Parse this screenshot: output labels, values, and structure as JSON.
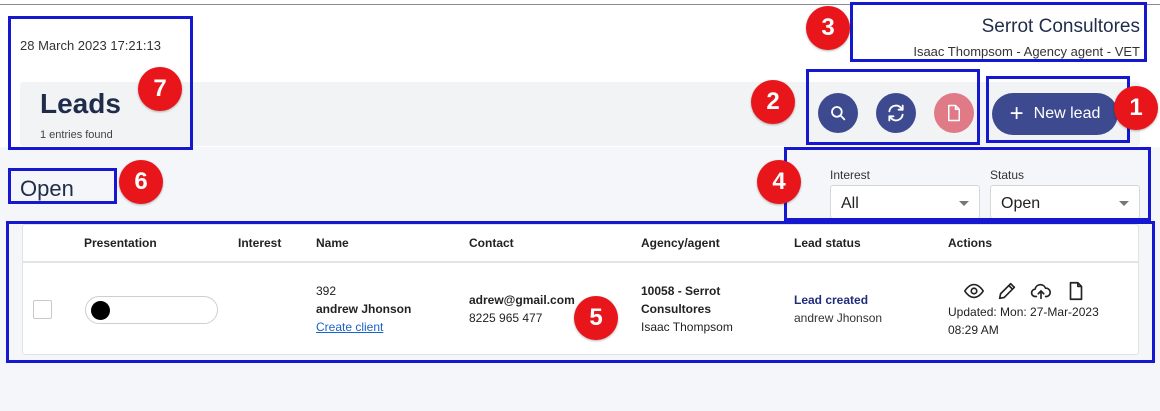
{
  "header": {
    "datetime": "28 March 2023 17:21:13",
    "company_name": "Serrot Consultores",
    "agent_line": "Isaac Thompsom - Agency agent - VET"
  },
  "leads": {
    "title": "Leads",
    "count": "1 entries found"
  },
  "toolbar": {
    "new_lead_label": "New lead",
    "search_icon": "search-icon",
    "refresh_icon": "refresh-icon",
    "pdf_icon": "document-icon"
  },
  "section_label": "Open",
  "filters": {
    "interest": {
      "label": "Interest",
      "value": "All"
    },
    "status": {
      "label": "Status",
      "value": "Open"
    }
  },
  "table": {
    "columns": [
      "Presentation",
      "Interest",
      "Name",
      "Contact",
      "Agency/agent",
      "Lead status",
      "Actions"
    ],
    "rows": [
      {
        "id": "392",
        "name": "andrew Jhonson",
        "create_client": "Create client",
        "email": "adrew@gmail.com",
        "phone": "8225 965 477",
        "agency_line1": "10058 - Serrot",
        "agency_line2": "Consultores",
        "agent": "Isaac Thompsom",
        "lead_status": "Lead created",
        "lead_owner": "andrew Jhonson",
        "updated_line1": "Updated: Mon: 27-Mar-2023",
        "updated_line2": "08:29 AM"
      }
    ]
  },
  "annotations": [
    "1",
    "2",
    "3",
    "4",
    "5",
    "6",
    "7"
  ],
  "colors": {
    "primary": "#3d4a8f",
    "pdf": "#e07a86",
    "annotation_box": "#1518d0",
    "annotation_badge": "#e8151b"
  }
}
